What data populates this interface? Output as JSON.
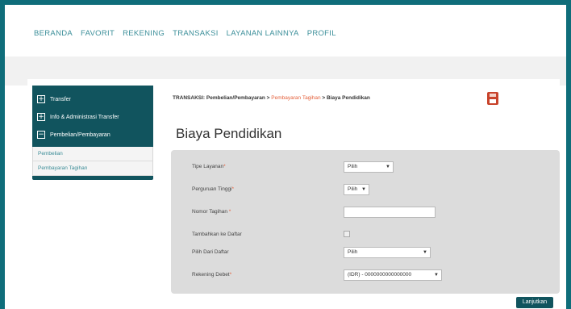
{
  "topnav": {
    "items": [
      "BERANDA",
      "FAVORIT",
      "REKENING",
      "TRANSAKSI",
      "LAYANAN LAINNYA",
      "PROFIL"
    ]
  },
  "sidebar": {
    "groups": [
      {
        "label": "Transfer",
        "icon": "+"
      },
      {
        "label": "Info & Administrasi Transfer",
        "icon": "+"
      },
      {
        "label": "Pembelian/Pembayaran",
        "icon": "−"
      }
    ],
    "subitems": [
      "Pembelian",
      "Pembayaran Tagihan"
    ]
  },
  "breadcrumb": {
    "part1": "TRANSAKSI: Pembelian/Pembayaran > ",
    "part2": "Pembayaran Tagihan",
    "part3": " > Biaya Pendidikan"
  },
  "page_title": "Biaya Pendidikan",
  "form": {
    "tipe_layanan": {
      "label": "Tipe Layanan",
      "value": "Pilih"
    },
    "perguruan_tinggi": {
      "label": "Perguruan Tinggi",
      "value": "Pilih"
    },
    "nomor_tagihan": {
      "label": "Nomor Tagihan",
      "value": ""
    },
    "tambahkan_daftar": {
      "label": "Tambahkan ke Daftar"
    },
    "pilih_daftar": {
      "label": "Pilih Dari Daftar",
      "value": "Pilih"
    },
    "rekening_debet": {
      "label": "Rekening Debet",
      "value": "(IDR) - 0000000000000000"
    }
  },
  "submit_label": "Lanjutkan",
  "colors": {
    "teal_dark": "#11545e",
    "teal_border": "#0f6d7a",
    "accent_orange": "#e4603b",
    "panel_grey": "#dcdcdc"
  }
}
